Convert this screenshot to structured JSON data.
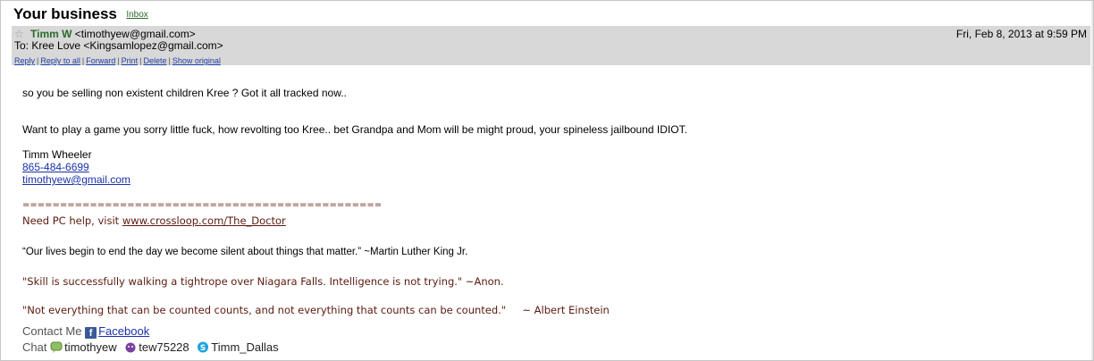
{
  "subject": "Your business",
  "folder_label": "Inbox",
  "header": {
    "from_name": "Timm W",
    "from_email": "<timothyew@gmail.com>",
    "to_line": "To: Kree Love <Kingsamlopez@gmail.com>",
    "date": "Fri, Feb 8, 2013 at 9:59 PM",
    "actions": [
      "Reply",
      "Reply to all",
      "Forward",
      "Print",
      "Delete",
      "Show original"
    ]
  },
  "body": {
    "line1": "so you be selling non existent children Kree ?  Got it all tracked now..",
    "line2": "Want to play a game you sorry little fuck, how revolting too Kree.. bet Grandpa and Mom will be might proud, your spineless jailbound IDIOT.",
    "sig_name": "Timm Wheeler",
    "sig_phone": "865-484-6699",
    "sig_email": "timothyew@gmail.com",
    "separator": "================================================",
    "pc_help_prefix": "Need PC help, visit ",
    "pc_help_link": "www.crossloop.com/The_Doctor",
    "quote1": "“Our lives begin to end the day we become silent about things that matter.” ~Martin Luther King Jr.",
    "quote2": "\"Skill is successfully walking a tightrope over Niagara Falls. Intelligence is not trying.\" ~Anon.",
    "quote3": "\"Not everything that can be counted counts, and not everything that counts can be counted.\"     ~ Albert Einstein",
    "contact_label": "Contact Me",
    "facebook_label": "Facebook",
    "chat_label": "Chat",
    "chat_ids": [
      "timothyew",
      "tew75228",
      "Timm_Dallas"
    ]
  }
}
